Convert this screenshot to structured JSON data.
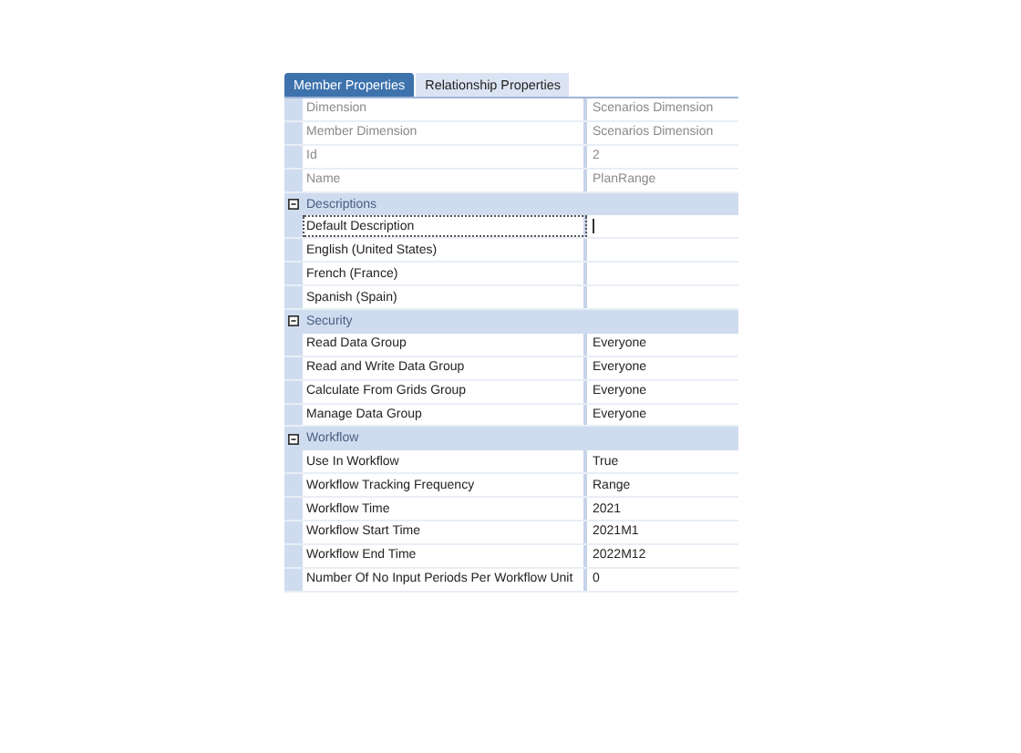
{
  "tabs": [
    {
      "label": "Member Properties",
      "selected": true
    },
    {
      "label": "Relationship Properties",
      "selected": false
    }
  ],
  "groups": [
    {
      "rows": [
        {
          "label": "Dimension",
          "value": "Scenarios Dimension",
          "readonly": true,
          "selected": false
        },
        {
          "label": "Member Dimension",
          "value": "Scenarios Dimension",
          "readonly": true,
          "selected": false
        },
        {
          "label": "Id",
          "value": "2",
          "readonly": true,
          "selected": false
        },
        {
          "label": "Name",
          "value": "PlanRange",
          "readonly": true,
          "selected": false
        }
      ]
    },
    {
      "name": "Descriptions",
      "expanded": true,
      "rows": [
        {
          "label": "Default Description",
          "readonly": false,
          "selected": true
        },
        {
          "label": "English (United States)",
          "readonly": false,
          "selected": false
        },
        {
          "label": "French (France)",
          "readonly": false,
          "selected": false
        },
        {
          "label": "Spanish (Spain)",
          "readonly": false,
          "selected": false
        }
      ]
    },
    {
      "name": "Security",
      "expanded": true,
      "rows": [
        {
          "label": "Read Data Group",
          "value": "Everyone",
          "readonly": false,
          "selected": false
        },
        {
          "label": "Read and Write Data Group",
          "value": "Everyone",
          "readonly": false,
          "selected": false
        },
        {
          "label": "Calculate From Grids Group",
          "value": "Everyone",
          "readonly": false,
          "selected": false
        },
        {
          "label": "Manage Data Group",
          "value": "Everyone",
          "readonly": false,
          "selected": false
        }
      ]
    },
    {
      "name": "Workflow",
      "expanded": true,
      "rows": [
        {
          "label": "Use In Workflow",
          "value": "True",
          "readonly": false,
          "selected": false
        },
        {
          "label": "Workflow Tracking Frequency",
          "value": "Range",
          "readonly": false,
          "selected": false
        },
        {
          "label": "Workflow Time",
          "value": "2021",
          "readonly": false,
          "selected": false
        },
        {
          "label": "Workflow Start Time",
          "value": "2021M1",
          "readonly": false,
          "selected": false
        },
        {
          "label": "Workflow End Time",
          "value": "2022M12",
          "readonly": false,
          "selected": false
        },
        {
          "label": "Number Of No Input Periods Per Workflow Unit",
          "value": "0",
          "readonly": false,
          "selected": false
        }
      ]
    }
  ]
}
